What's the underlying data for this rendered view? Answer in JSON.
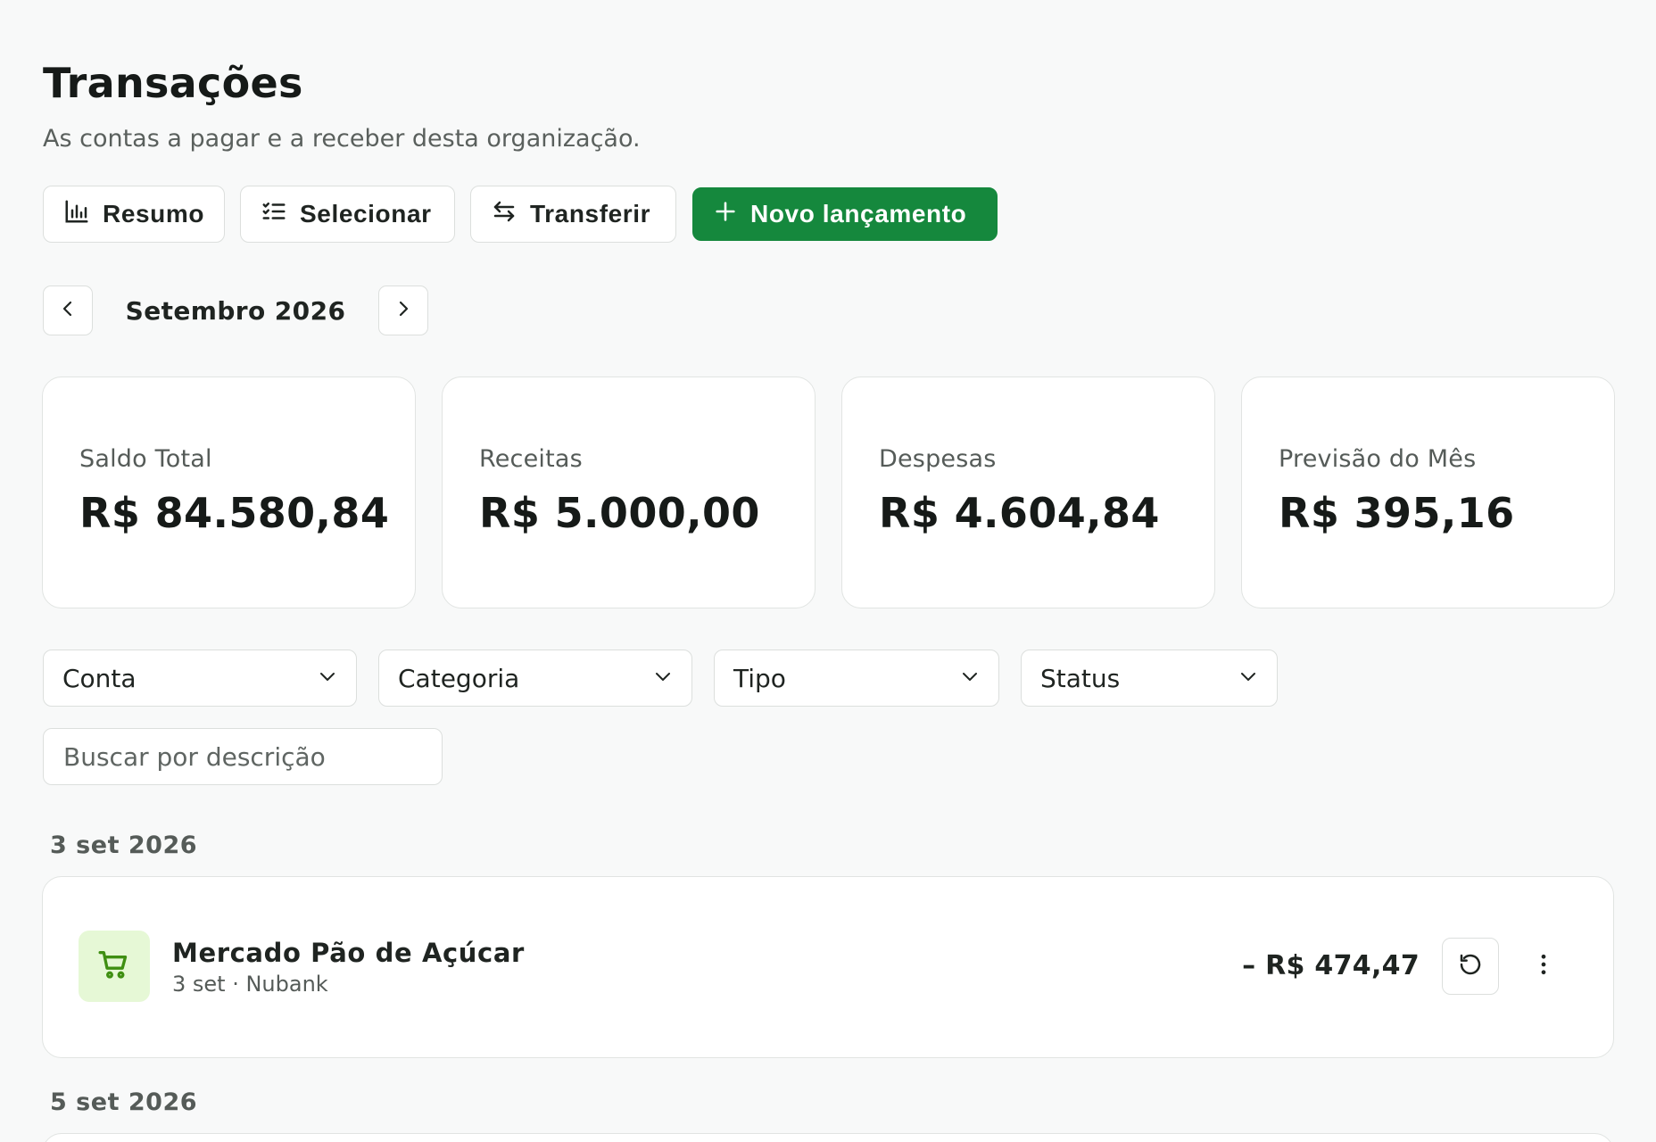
{
  "header": {
    "title": "Transações",
    "subtitle": "As contas a pagar e a receber desta organização."
  },
  "toolbar": {
    "summary_label": "Resumo",
    "select_label": "Selecionar",
    "transfer_label": "Transferir",
    "new_label": "Novo lançamento",
    "icons": [
      "bar-chart-icon",
      "checklist-icon",
      "arrows-swap-icon",
      "plus-icon"
    ],
    "accent_color": "#15883d"
  },
  "month_nav": {
    "label": "Setembro 2026"
  },
  "summary_cards": [
    {
      "label": "Saldo Total",
      "value": "R$ 84.580,84"
    },
    {
      "label": "Receitas",
      "value": "R$ 5.000,00"
    },
    {
      "label": "Despesas",
      "value": "R$ 4.604,84"
    },
    {
      "label": "Previsão do Mês",
      "value": "R$ 395,16"
    }
  ],
  "filters": {
    "account": "Conta",
    "category": "Categoria",
    "type": "Tipo",
    "status": "Status",
    "search_placeholder": "Buscar por descrição"
  },
  "groups": [
    {
      "date": "3 set 2026",
      "transactions": [
        {
          "name": "Mercado Pão de Açúcar",
          "meta": "3 set · Nubank",
          "amount": "– R$ 474,47",
          "icon": "shopping-cart-icon",
          "icon_bg": "#e6f8d6",
          "icon_color": "#3f8f12"
        }
      ]
    },
    {
      "date": "5 set 2026",
      "transactions": []
    }
  ]
}
